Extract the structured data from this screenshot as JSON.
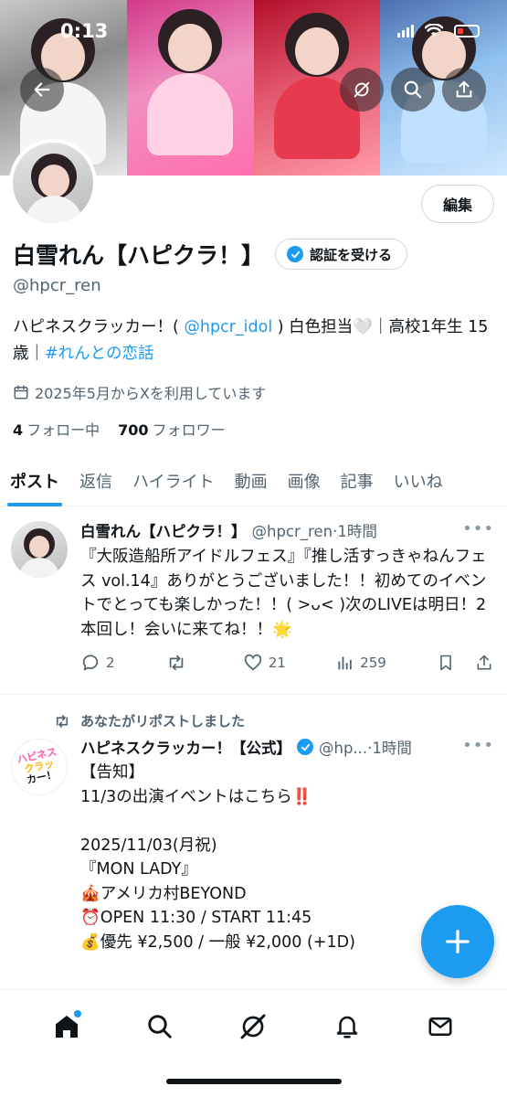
{
  "status_bar": {
    "time": "0:13"
  },
  "header_icons": [
    "back-arrow-icon",
    "grok-icon",
    "search-icon",
    "share-icon"
  ],
  "profile": {
    "edit_label": "編集",
    "display_name": "白雪れん【ハピクラ！】",
    "verify_label": "認証を受ける",
    "handle": "@hpcr_ren",
    "bio_part1": "ハピネスクラッカー！( ",
    "bio_mention": "@hpcr_idol",
    "bio_part2": " ) 白色担当🤍｜高校1年生 15歳｜",
    "bio_hashtag": "#れんとの恋話",
    "joined": "2025年5月からXを利用しています",
    "following_count": "4",
    "following_label": "フォロー中",
    "followers_count": "700",
    "followers_label": "フォロワー"
  },
  "tabs": [
    "ポスト",
    "返信",
    "ハイライト",
    "動画",
    "画像",
    "記事",
    "いいね"
  ],
  "posts": [
    {
      "name": "白雪れん【ハピクラ！】",
      "handle": "@hpcr_ren",
      "time": "·1時間",
      "text": "『大阪造船所アイドルフェス』『推し活すっきゃねんフェス vol.14』ありがとうございました！！初めてのイベントでとっても楽しかった！！( >ᴗ< )次のLIVEは明日！2本回し！会いに来てね！！🌟",
      "replies": "2",
      "reposts": "",
      "likes": "21",
      "views": "259"
    },
    {
      "repost_note": "あなたがリポストしました",
      "name": "ハピネスクラッカー！【公式】",
      "handle": "@hp...",
      "time": "·1時間",
      "text": "【告知】\n11/3の出演イベントはこちら‼️\n\n2025/11/03(月祝)\n『MON LADY』\n🎪アメリカ村BEYOND\n⏰OPEN 11:30 / START 11:45\n💰優先 ¥2,500 / 一般 ¥2,000 (+1D)",
      "logo_lines": [
        "ハピネス",
        "クラッ",
        "カー！"
      ]
    }
  ],
  "colors": {
    "accent": "#1d9bf0",
    "text": "#0f1419",
    "muted": "#536471"
  },
  "bottom_nav": [
    "home-icon",
    "search-icon",
    "grok-icon",
    "notifications-icon",
    "messages-icon"
  ]
}
